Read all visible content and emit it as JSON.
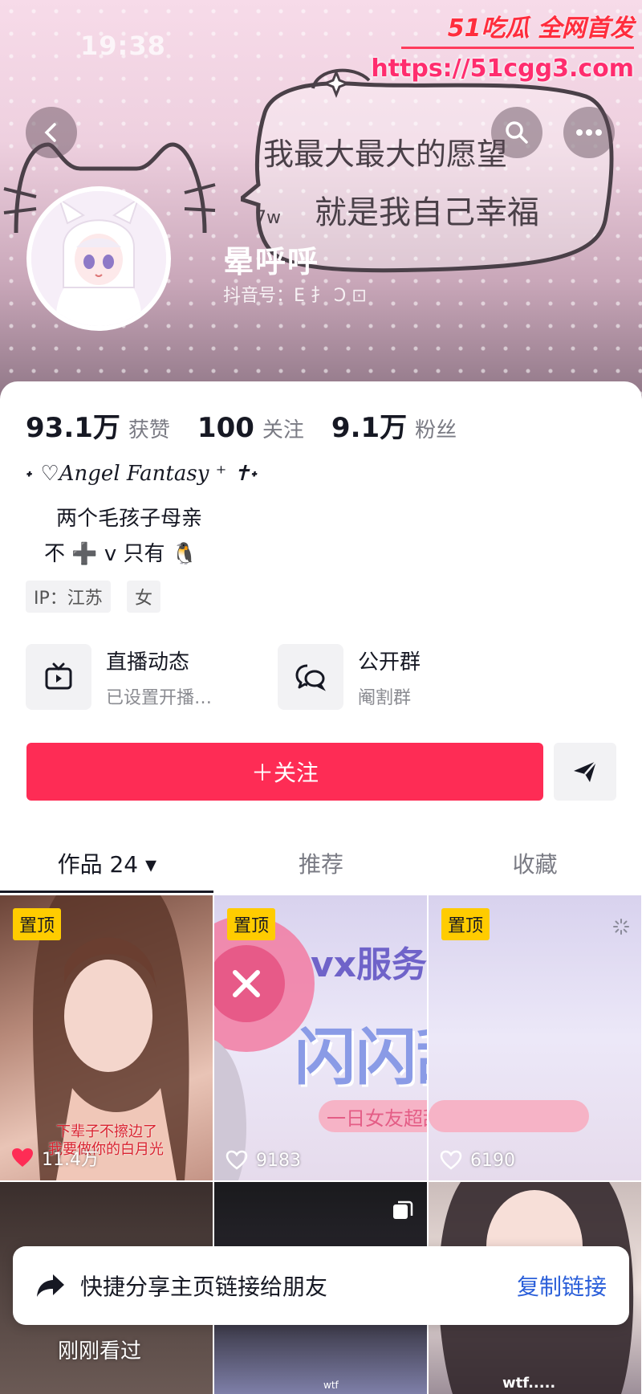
{
  "status_bar": {
    "time": "19:38"
  },
  "watermark": {
    "logo": "51吃瓜 全网首发",
    "url": "https://51cgg3.com"
  },
  "header": {
    "bubble_line1": "我最大最大的愿望",
    "bubble_line2": "就是我自己幸福",
    "bubble_prefix": "7w",
    "username": "晕呼呼",
    "douyin_id": "抖音号：E 扌          Ɔ ⊡"
  },
  "stats": [
    {
      "value": "93.1万",
      "label": "获赞"
    },
    {
      "value": "100",
      "label": "关注"
    },
    {
      "value": "9.1万",
      "label": "粉丝"
    }
  ],
  "bio": {
    "title": "˖ ♡Angel Fantasy  ⁺ ✝˖",
    "line1": "两个毛孩子母亲",
    "line2": "不 ➕ v 只有 🐧"
  },
  "tags": [
    "IP：江苏",
    "女"
  ],
  "features": [
    {
      "title": "直播动态",
      "subtitle": "已设置开播…",
      "icon": "tv-icon"
    },
    {
      "title": "公开群",
      "subtitle": "阉割群",
      "icon": "chat-bubbles-icon"
    }
  ],
  "actions": {
    "follow_label": "＋关注",
    "send_icon": "paper-plane-icon"
  },
  "tabs": [
    {
      "label": "作品 24 ▾",
      "active": true
    },
    {
      "label": "推荐",
      "active": false
    },
    {
      "label": "收藏",
      "active": false
    }
  ],
  "videos": [
    {
      "pinned": "置顶",
      "likes": "11.4万",
      "caption_line1": "下辈子不擦边了",
      "caption_line2": "我要做你的白月光",
      "liked": true
    },
    {
      "pinned": "置顶",
      "likes": "9183",
      "overlay_title": "vx服务耗：",
      "overlay_big": "闪闪甜恋",
      "overlay_sub": "一日女友超甜体验",
      "liked": false
    },
    {
      "pinned": "置顶",
      "likes": "6190",
      "liked": false
    }
  ],
  "bottom_row": {
    "wtf1": "wtf",
    "wtf2": "wtf....."
  },
  "share_bar": {
    "text": "快捷分享主页链接给朋友",
    "action": "复制链接"
  },
  "recently_viewed": "刚刚看过",
  "colors": {
    "accent": "#fe2c55",
    "pin": "#ffcc00",
    "link": "#2b5fd9"
  }
}
